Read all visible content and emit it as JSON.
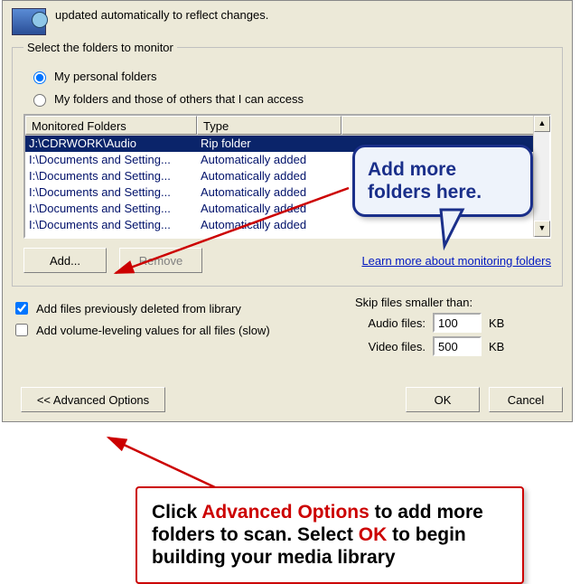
{
  "intro": "updated automatically to reflect changes.",
  "group_legend": "Select the folders to monitor",
  "radios": {
    "personal": "My personal folders",
    "others": "My folders and those of others that I can access"
  },
  "columns": {
    "folder": "Monitored Folders",
    "type": "Type"
  },
  "rows": [
    {
      "folder": "J:\\CDRWORK\\Audio",
      "type": "Rip folder",
      "selected": true
    },
    {
      "folder": "I:\\Documents and Setting...",
      "type": "Automatically added"
    },
    {
      "folder": "I:\\Documents and Setting...",
      "type": "Automatically added"
    },
    {
      "folder": "I:\\Documents and Setting...",
      "type": "Automatically added"
    },
    {
      "folder": "I:\\Documents and Setting...",
      "type": "Automatically added"
    },
    {
      "folder": "I:\\Documents and Setting...",
      "type": "Automatically added"
    }
  ],
  "buttons": {
    "add": "Add...",
    "remove": "Remove",
    "advanced": "<< Advanced Options",
    "ok": "OK",
    "cancel": "Cancel"
  },
  "learn_link": "Learn more about monitoring folders",
  "checks": {
    "deleted": "Add files previously deleted from library",
    "volume": "Add volume-leveling values for all files (slow)"
  },
  "skip": {
    "title": "Skip files smaller than:",
    "audio_label": "Audio files:",
    "video_label": "Video files.",
    "audio_value": "100",
    "video_value": "500",
    "unit": "KB"
  },
  "callouts": {
    "add_more": "Add more folders here.",
    "advanced_html": [
      "Click ",
      "Advanced Options",
      " to add more folders to scan. Select ",
      "OK",
      " to begin building your media library"
    ]
  }
}
